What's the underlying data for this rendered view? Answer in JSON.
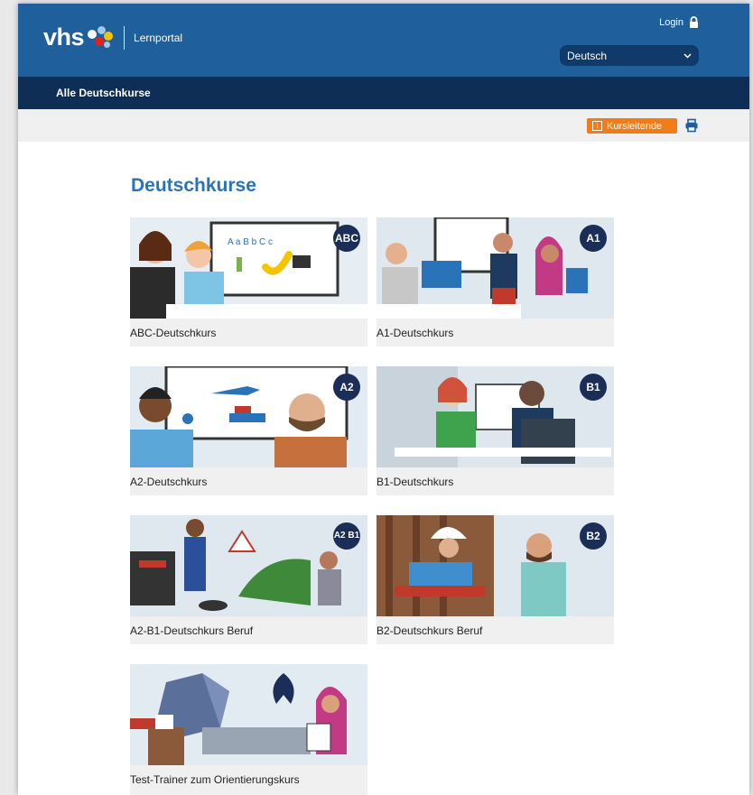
{
  "header": {
    "logo": "vhs",
    "subtitle": "Lernportal",
    "login_label": "Login",
    "language_selected": "Deutsch"
  },
  "nav": {
    "all_courses": "Alle Deutschkurse"
  },
  "toolbar": {
    "instructor_button": "Kursleitende"
  },
  "main": {
    "title": "Deutschkurse",
    "courses": [
      {
        "label": "ABC-Deutschkurs",
        "badge": "ABC"
      },
      {
        "label": "A1-Deutschkurs",
        "badge": "A1"
      },
      {
        "label": "A2-Deutschkurs",
        "badge": "A2"
      },
      {
        "label": "B1-Deutschkurs",
        "badge": "B1"
      },
      {
        "label": "A2-B1-Deutschkurs Beruf",
        "badge": "A2 B1"
      },
      {
        "label": "B2-Deutschkurs Beruf",
        "badge": "B2"
      },
      {
        "label": "Test-Trainer zum Orientierungskurs",
        "badge": ""
      }
    ]
  },
  "colors": {
    "header_blue": "#1f5f9b",
    "nav_dark": "#0f2e55",
    "accent_orange": "#f07d1a",
    "title_blue": "#2b73b8",
    "badge_navy": "#1b2e57"
  }
}
